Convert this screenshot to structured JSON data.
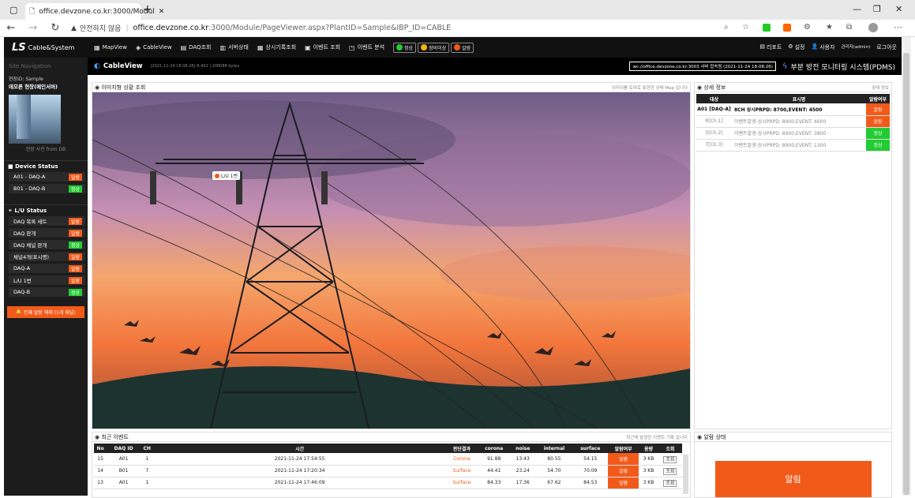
{
  "browser": {
    "tab_title": "office.devzone.co.kr:3000/Modul",
    "warning": "안전하지 않음",
    "url_host": "office.devzone.co.kr",
    "url_rest": ":3000/Module/PageViewer.aspx?PlantID=Sample&IBP_ID=CABLE"
  },
  "sidebar": {
    "logo_ls": "LS",
    "logo_sub": "Cable&System",
    "site_nav": "Site Navigation",
    "site_id": "현장ID: Sample",
    "site_name": "데모론 현장(메인서버)",
    "photo_caption": "현장 사진 from DB",
    "device_title": "Device Status",
    "devices": [
      {
        "label": "A01 - DAQ-A",
        "status": "알람",
        "color": "#f25a1a"
      },
      {
        "label": "B01 - DAQ-B",
        "status": "정상",
        "color": "#22cc33"
      }
    ],
    "lu_title": "L/U Status",
    "lu_items": [
      {
        "label": "DAQ 목록 세트",
        "status": "알람",
        "color": "#f25a1a"
      },
      {
        "label": "DAQ 판개",
        "status": "알람",
        "color": "#f25a1a"
      },
      {
        "label": "DAQ 채널 판개",
        "status": "정상",
        "color": "#22cc33"
      },
      {
        "label": "채널4개(표시명)",
        "status": "알람",
        "color": "#f25a1a"
      },
      {
        "label": "DAQ-A",
        "status": "알람",
        "color": "#f25a1a"
      },
      {
        "label": "L/U 1번",
        "status": "알람",
        "color": "#f25a1a"
      },
      {
        "label": "DAQ-B",
        "status": "정상",
        "color": "#22cc33"
      }
    ],
    "alarm_button": "전체 알람 해제 (1개 채널)"
  },
  "topnav": {
    "items": [
      "MapView",
      "CableView",
      "DAQ조회",
      "서버상태",
      "상시기록조회",
      "이벤트 조회",
      "이벤트 분석"
    ],
    "status_pills": [
      {
        "label": "정상",
        "color": "#22cc33"
      },
      {
        "label": "장비이상",
        "color": "#f0b020"
      },
      {
        "label": "알람",
        "color": "#f25a1a"
      }
    ],
    "right": [
      "리포트",
      "설정",
      "사용자",
      "관리자(admin)",
      "로그아웃"
    ]
  },
  "subnav": {
    "title": "CableView",
    "meta": "[2021-11-24 18:08:26] R-402 | 208088 bytes",
    "server": "wc://office.devzone.co.kr:3003 서버 접속됨 (2021-11-24 18:08:26)",
    "system_title": "부분 방전 모니터링 시스템(PDMS)"
  },
  "image_panel": {
    "title": "이미지형 상황 조회",
    "hint": "이미지를 토대로 표현한 상태 Map 입니다",
    "marker": "L/U 1번"
  },
  "detail": {
    "title": "상세 정보",
    "hint": "상태 정보",
    "headers": [
      "대상",
      "표시명",
      "알람여부"
    ],
    "rows": [
      {
        "target": "A01 [DAQ-A]",
        "name": "8CH 상시PRPD: 8700,EVENT: 4500",
        "status": "알람",
        "color": "#f25a1a",
        "bold": true
      },
      {
        "target": "R[Ch.1]",
        "name": "이벤트발생-상시PRPD: 8900,EVENT: 4600",
        "status": "알람",
        "color": "#f25a1a",
        "bold": false
      },
      {
        "target": "S[Ch.2]",
        "name": "이벤트발생-상시PRPD: 8900,EVENT: 3800",
        "status": "정상",
        "color": "#22cc33",
        "bold": false
      },
      {
        "target": "T[Ch.3]",
        "name": "이벤트발생-상시PRPD: 8900,EVENT: 1300",
        "status": "정상",
        "color": "#22cc33",
        "bold": false
      }
    ]
  },
  "events": {
    "title": "최근 이벤트",
    "hint": "최근에 발생한 이벤트 기록 입니다",
    "headers": [
      "No",
      "DAQ ID",
      "CH",
      "시간",
      "판단결과",
      "corona",
      "noise",
      "internal",
      "surface",
      "알람여부",
      "용량",
      "조회"
    ],
    "rows": [
      [
        "15",
        "A01",
        "1",
        "2021-11-24 17:54:55",
        "Corona",
        "91.88",
        "13.43",
        "80.55",
        "54.15",
        "알람",
        "3 KB",
        "조회"
      ],
      [
        "14",
        "B01",
        "7",
        "2021-11-24 17:20:34",
        "Surface",
        "44.41",
        "23.24",
        "54.70",
        "70.09",
        "알람",
        "3 KB",
        "조회"
      ],
      [
        "13",
        "A01",
        "1",
        "2021-11-24 17:46:09",
        "Surface",
        "84.33",
        "17.36",
        "67.62",
        "84.53",
        "알람",
        "3 KB",
        "조회"
      ]
    ]
  },
  "alarm": {
    "title": "알람 상태",
    "value": "알림"
  }
}
